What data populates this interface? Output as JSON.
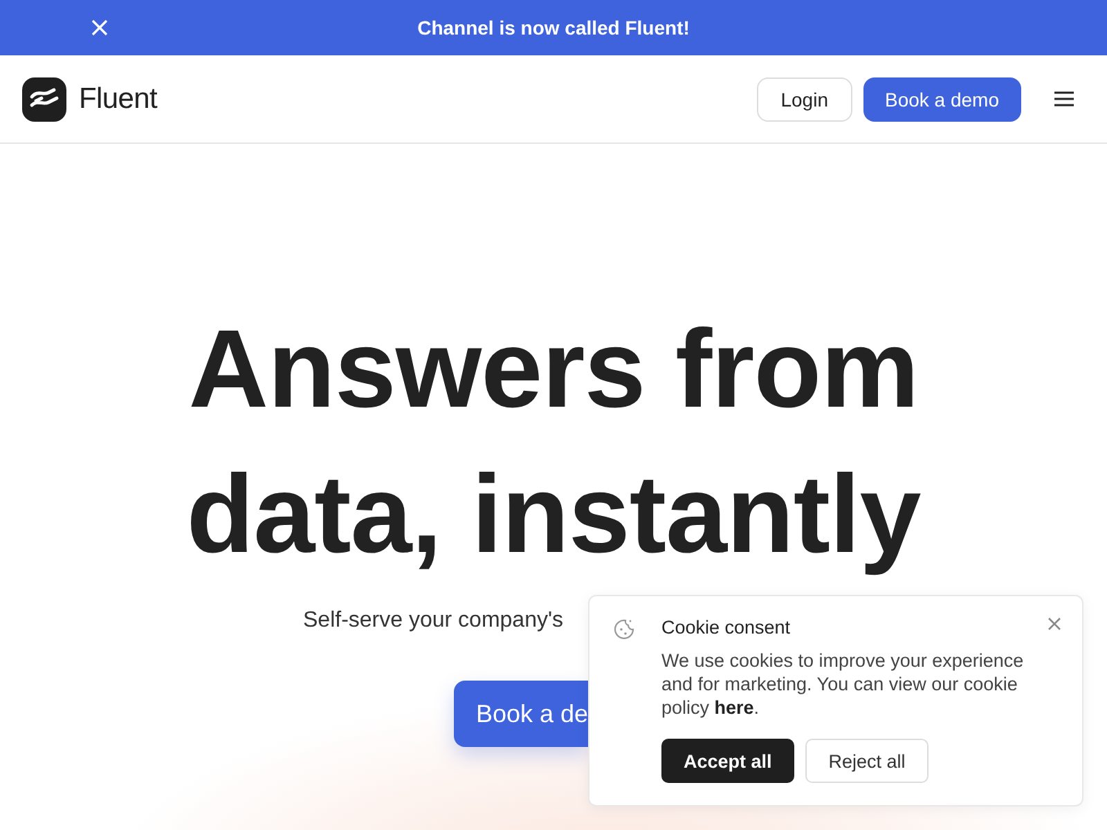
{
  "announcement": {
    "text": "Channel is now called Fluent!"
  },
  "header": {
    "brand": "Fluent",
    "login": "Login",
    "demo": "Book a demo"
  },
  "hero": {
    "title_lines": [
      "Answers from",
      "data, instantly"
    ],
    "subtitle": "Self-serve your company's",
    "cta": "Book a de"
  },
  "cookie": {
    "title": "Cookie consent",
    "body_text": "We use cookies to improve your experience and for marketing. You can view our cookie policy ",
    "link": "here",
    "body_end": ".",
    "accept": "Accept all",
    "reject": "Reject all"
  }
}
